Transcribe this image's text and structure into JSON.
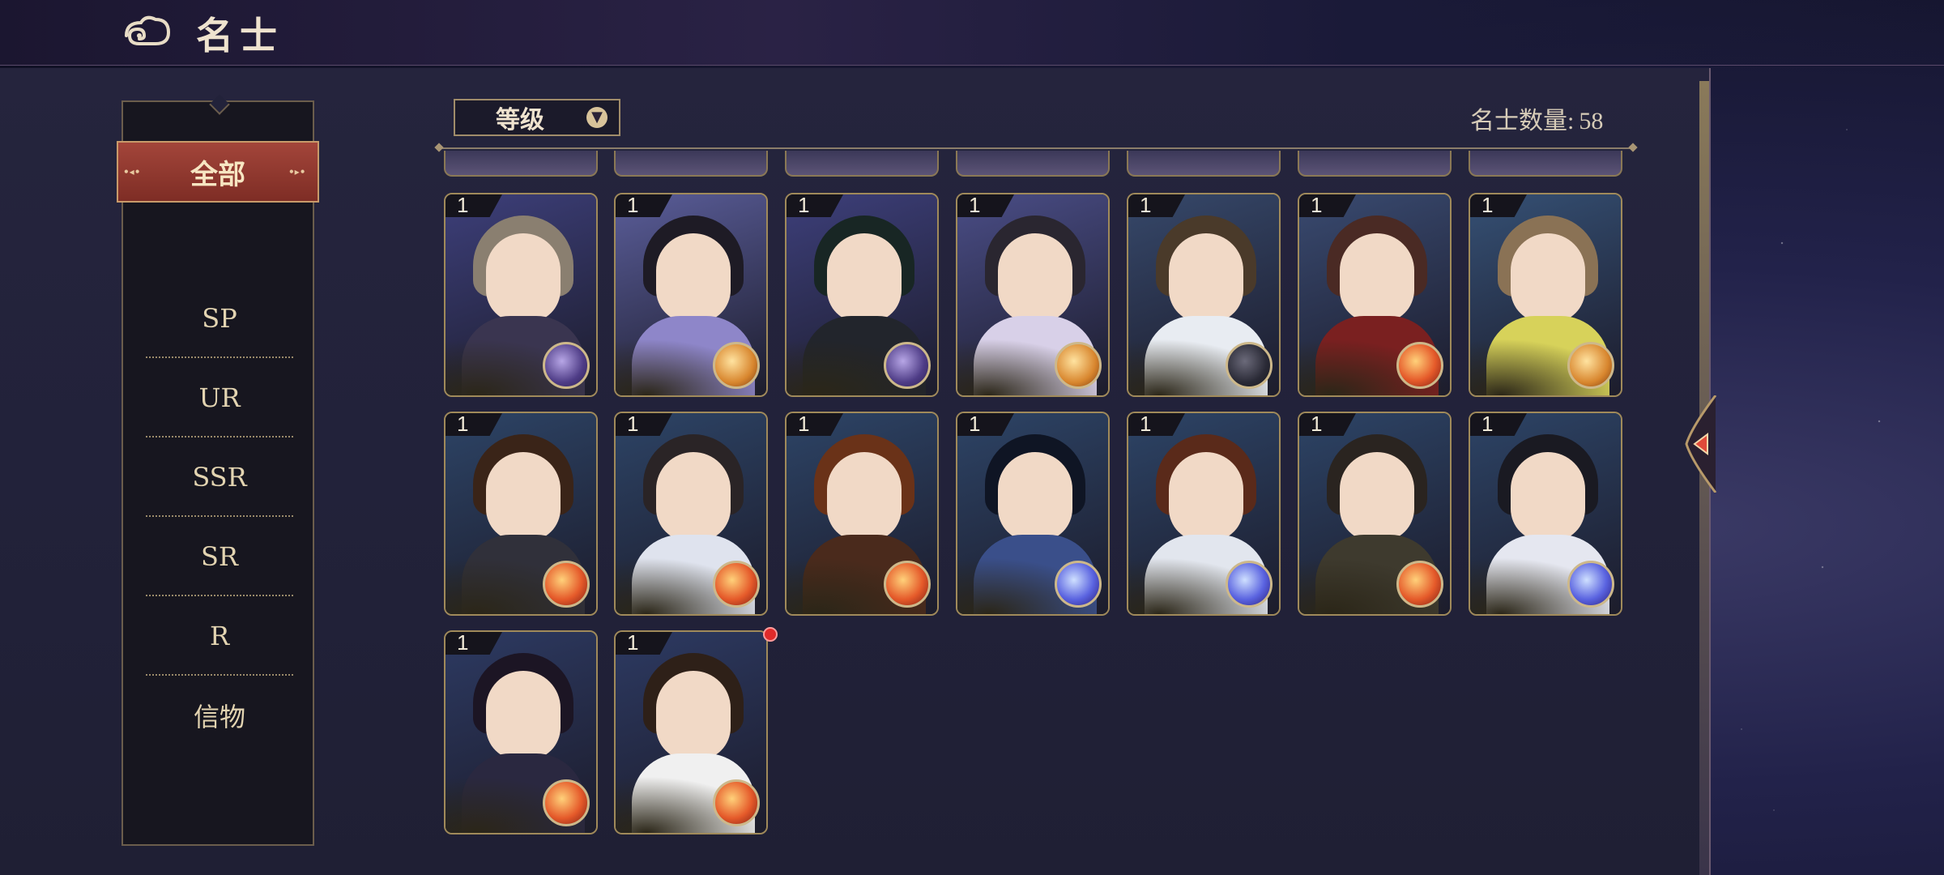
{
  "header": {
    "title": "名士",
    "back_icon": "cloud-back-icon"
  },
  "sidebar": {
    "items": [
      {
        "label": "全部",
        "active": true
      },
      {
        "label": "SP",
        "active": false
      },
      {
        "label": "UR",
        "active": false
      },
      {
        "label": "SSR",
        "active": false
      },
      {
        "label": "SR",
        "active": false
      },
      {
        "label": "R",
        "active": false
      },
      {
        "label": "信物",
        "active": false
      }
    ]
  },
  "toolbar": {
    "sort_label": "等级",
    "sort_icon": "chevron-down-icon",
    "count_label": "名士数量:",
    "count_value": "58"
  },
  "cards": [
    {
      "level": "1",
      "element": "purple",
      "hair": "#8a7f70",
      "outfit": "#3a3550",
      "bg": "#3d3f7a"
    },
    {
      "level": "1",
      "element": "gold",
      "hair": "#1e1b25",
      "outfit": "#8e86c9",
      "bg": "#5a5d99"
    },
    {
      "level": "1",
      "element": "purple",
      "hair": "#182624",
      "outfit": "#22252c",
      "bg": "#3d3f7a"
    },
    {
      "level": "1",
      "element": "gold",
      "hair": "#2a2630",
      "outfit": "#d8d0e8",
      "bg": "#4a4d86"
    },
    {
      "level": "1",
      "element": "dark",
      "hair": "#4a3a2a",
      "outfit": "#e8ecf2",
      "bg": "#36486a"
    },
    {
      "level": "1",
      "element": "red",
      "hair": "#4a2a24",
      "outfit": "#7a2020",
      "bg": "#394a70"
    },
    {
      "level": "1",
      "element": "gold",
      "hair": "#8a7255",
      "outfit": "#d7d25a",
      "bg": "#355074"
    },
    {
      "level": "1",
      "element": "red",
      "hair": "#3a2418",
      "outfit": "#30303a",
      "bg": "#2d4466"
    },
    {
      "level": "1",
      "element": "red",
      "hair": "#2a2426",
      "outfit": "#dfe3ee",
      "bg": "#2d4466"
    },
    {
      "level": "1",
      "element": "red",
      "hair": "#6a3218",
      "outfit": "#4a2a1c",
      "bg": "#2d4466"
    },
    {
      "level": "1",
      "element": "blue",
      "hair": "#0f1524",
      "outfit": "#3a4f8a",
      "bg": "#2d4466"
    },
    {
      "level": "1",
      "element": "blue",
      "hair": "#5a2a1a",
      "outfit": "#e2e6ee",
      "bg": "#2d4466"
    },
    {
      "level": "1",
      "element": "red",
      "hair": "#2a2420",
      "outfit": "#3e3a2e",
      "bg": "#2d4466"
    },
    {
      "level": "1",
      "element": "blue",
      "hair": "#1a1a22",
      "outfit": "#e5e7f0",
      "bg": "#2d4466"
    },
    {
      "level": "1",
      "element": "red",
      "hair": "#1c1524",
      "outfit": "#2a2840",
      "bg": "#2d3a62"
    },
    {
      "level": "1",
      "element": "red",
      "hair": "#2e2018",
      "outfit": "#f0f0f0",
      "bg": "#2d3a62"
    }
  ]
}
